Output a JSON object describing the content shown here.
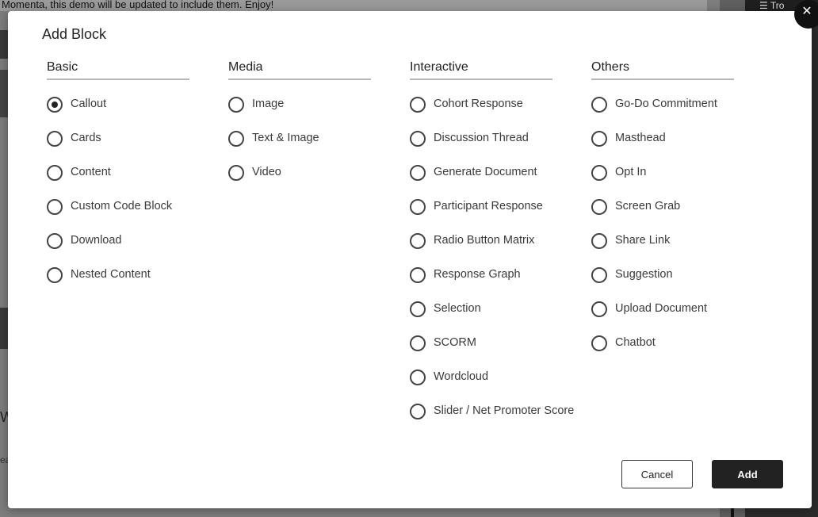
{
  "background": {
    "banner_text": "Momenta, this demo will be updated to include them. Enjoy!",
    "right_top_text": "☰  Tro",
    "left_letter_1": "W",
    "left_letter_2": "ea"
  },
  "modal": {
    "title": "Add Block",
    "close_label": "✕",
    "columns": [
      {
        "heading": "Basic",
        "options": [
          "Callout",
          "Cards",
          "Content",
          "Custom Code Block",
          "Download",
          "Nested Content"
        ]
      },
      {
        "heading": "Media",
        "options": [
          "Image",
          "Text & Image",
          "Video"
        ]
      },
      {
        "heading": "Interactive",
        "options": [
          "Cohort Response",
          "Discussion Thread",
          "Generate Document",
          "Participant Response",
          "Radio Button Matrix",
          "Response Graph",
          "Selection",
          "SCORM",
          "Wordcloud",
          "Slider / Net Promoter Score"
        ]
      },
      {
        "heading": "Others",
        "options": [
          "Go-Do Commitment",
          "Masthead",
          "Opt In",
          "Screen Grab",
          "Share Link",
          "Suggestion",
          "Upload Document",
          "Chatbot"
        ]
      }
    ],
    "selected": "Callout",
    "cancel_label": "Cancel",
    "add_label": "Add"
  }
}
